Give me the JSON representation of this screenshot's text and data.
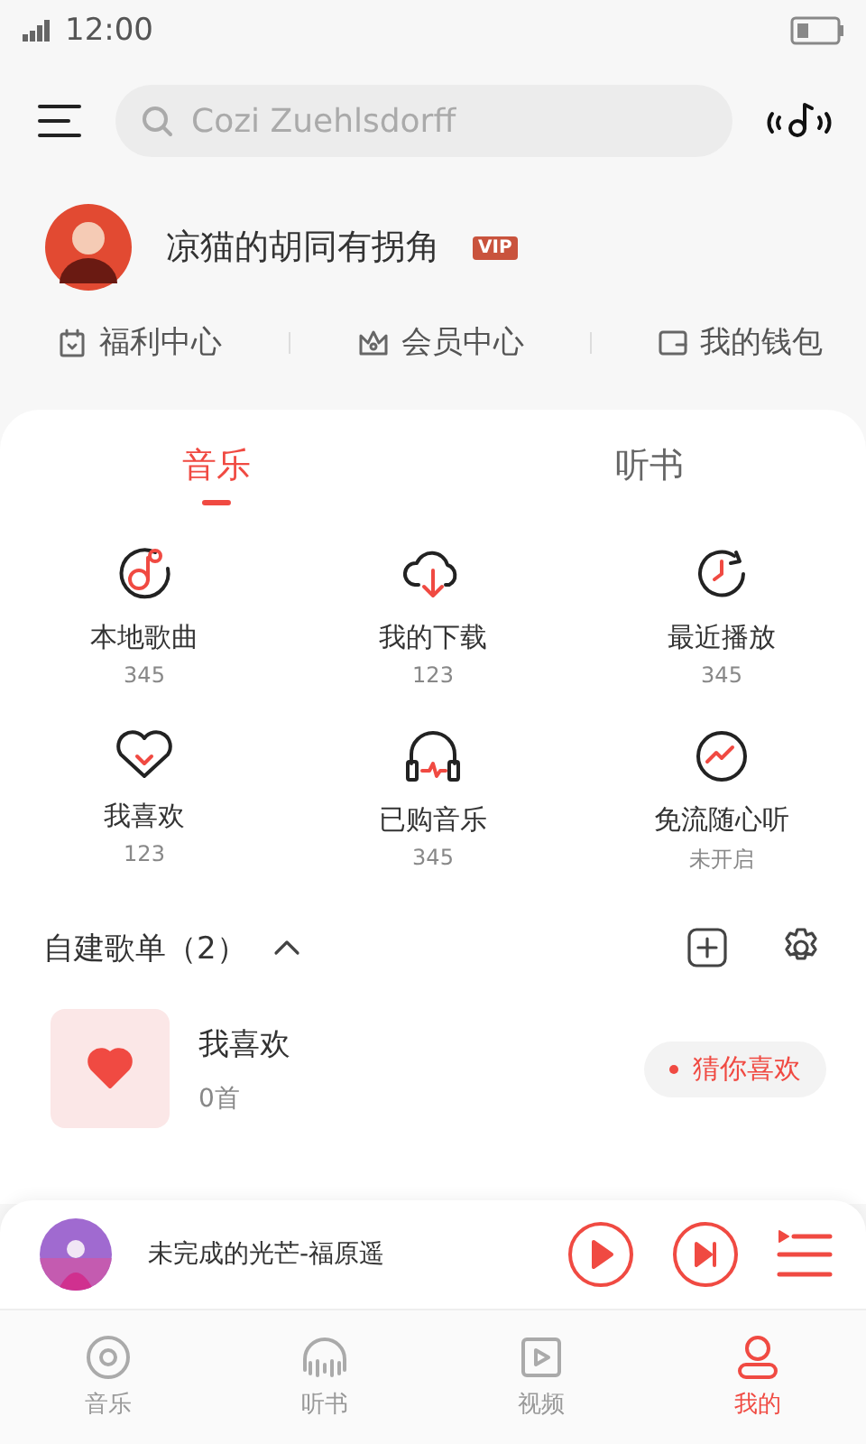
{
  "status_bar": {
    "time": "12:00"
  },
  "search": {
    "placeholder": "Cozi Zuehlsdorff"
  },
  "profile": {
    "name": "凉猫的胡同有拐角",
    "badge": "VIP"
  },
  "links": [
    {
      "label": "福利中心"
    },
    {
      "label": "会员中心"
    },
    {
      "label": "我的钱包"
    }
  ],
  "tabs": [
    {
      "label": "音乐",
      "selected": true
    },
    {
      "label": "听书",
      "selected": false
    }
  ],
  "features": [
    {
      "label": "本地歌曲",
      "count": "345"
    },
    {
      "label": "我的下载",
      "count": "123"
    },
    {
      "label": "最近播放",
      "count": "345"
    },
    {
      "label": "我喜欢",
      "count": "123"
    },
    {
      "label": "已购音乐",
      "count": "345"
    },
    {
      "label": "免流随心听",
      "count": "未开启"
    }
  ],
  "playlists": {
    "title": "自建歌单（2）",
    "expanded": true,
    "items": [
      {
        "name": "我喜欢",
        "count": "0首"
      }
    ],
    "suggestion": "猜你喜欢"
  },
  "player": {
    "track": "未完成的光芒-福原遥"
  },
  "nav": [
    {
      "label": "音乐",
      "selected": false
    },
    {
      "label": "听书",
      "selected": false
    },
    {
      "label": "视频",
      "selected": false
    },
    {
      "label": "我的",
      "selected": true
    }
  ]
}
